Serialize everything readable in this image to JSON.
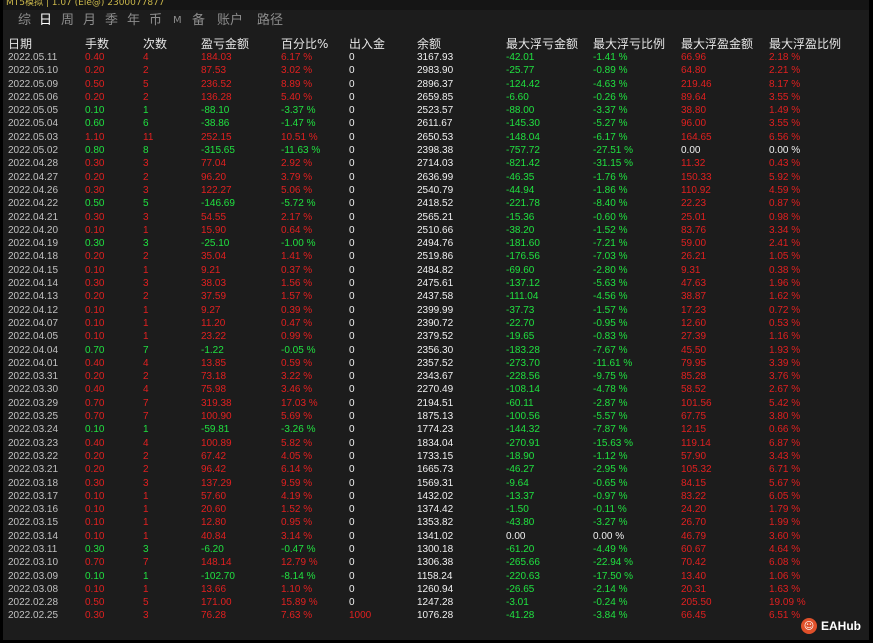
{
  "window": {
    "title": "MT5模拟 | 1.07 (Ele@) 2300077877"
  },
  "tabs": [
    {
      "label": "综",
      "active": false,
      "small": false
    },
    {
      "label": "日",
      "active": true,
      "small": false
    },
    {
      "label": "周",
      "active": false,
      "small": false
    },
    {
      "label": "月",
      "active": false,
      "small": false
    },
    {
      "label": "季",
      "active": false,
      "small": false
    },
    {
      "label": "年",
      "active": false,
      "small": false
    },
    {
      "label": "币",
      "active": false,
      "small": false
    },
    {
      "label": "M",
      "active": false,
      "small": true
    },
    {
      "label": "备",
      "active": false,
      "small": false
    },
    {
      "label": "账户",
      "active": false,
      "small": false
    },
    {
      "label": "路径",
      "active": false,
      "small": false
    }
  ],
  "columns": [
    "日期",
    "手数",
    "次数",
    "盈亏金额",
    "百分比%",
    "出入金",
    "余额",
    "最大浮亏金额",
    "最大浮亏比例",
    "最大浮盈金额",
    "最大浮盈比例"
  ],
  "colors": {
    "loss": "#e02020",
    "profit": "#20e040",
    "neutral": "#f0f0f0",
    "date": "#c0c0c0"
  },
  "rows": [
    [
      "2022.05.11",
      "0.40",
      "4",
      "184.03",
      "6.17 %",
      "0",
      "3167.93",
      "-42.01",
      "-1.41 %",
      "66.96",
      "2.18 %"
    ],
    [
      "2022.05.10",
      "0.20",
      "2",
      "87.53",
      "3.02 %",
      "0",
      "2983.90",
      "-25.77",
      "-0.89 %",
      "64.80",
      "2.21 %"
    ],
    [
      "2022.05.09",
      "0.50",
      "5",
      "236.52",
      "8.89 %",
      "0",
      "2896.37",
      "-124.42",
      "-4.63 %",
      "219.46",
      "8.17 %"
    ],
    [
      "2022.05.06",
      "0.20",
      "2",
      "136.28",
      "5.40 %",
      "0",
      "2659.85",
      "-6.60",
      "-0.26 %",
      "89.64",
      "3.55 %"
    ],
    [
      "2022.05.05",
      "0.10",
      "1",
      "-88.10",
      "-3.37 %",
      "0",
      "2523.57",
      "-88.00",
      "-3.37 %",
      "38.80",
      "1.49 %"
    ],
    [
      "2022.05.04",
      "0.60",
      "6",
      "-38.86",
      "-1.47 %",
      "0",
      "2611.67",
      "-145.30",
      "-5.27 %",
      "96.00",
      "3.55 %"
    ],
    [
      "2022.05.03",
      "1.10",
      "11",
      "252.15",
      "10.51 %",
      "0",
      "2650.53",
      "-148.04",
      "-6.17 %",
      "164.65",
      "6.56 %"
    ],
    [
      "2022.05.02",
      "0.80",
      "8",
      "-315.65",
      "-11.63 %",
      "0",
      "2398.38",
      "-757.72",
      "-27.51 %",
      "0.00",
      "0.00 %"
    ],
    [
      "2022.04.28",
      "0.30",
      "3",
      "77.04",
      "2.92 %",
      "0",
      "2714.03",
      "-821.42",
      "-31.15 %",
      "11.32",
      "0.43 %"
    ],
    [
      "2022.04.27",
      "0.20",
      "2",
      "96.20",
      "3.79 %",
      "0",
      "2636.99",
      "-46.35",
      "-1.76 %",
      "150.33",
      "5.92 %"
    ],
    [
      "2022.04.26",
      "0.30",
      "3",
      "122.27",
      "5.06 %",
      "0",
      "2540.79",
      "-44.94",
      "-1.86 %",
      "110.92",
      "4.59 %"
    ],
    [
      "2022.04.22",
      "0.50",
      "5",
      "-146.69",
      "-5.72 %",
      "0",
      "2418.52",
      "-221.78",
      "-8.40 %",
      "22.23",
      "0.87 %"
    ],
    [
      "2022.04.21",
      "0.30",
      "3",
      "54.55",
      "2.17 %",
      "0",
      "2565.21",
      "-15.36",
      "-0.60 %",
      "25.01",
      "0.98 %"
    ],
    [
      "2022.04.20",
      "0.10",
      "1",
      "15.90",
      "0.64 %",
      "0",
      "2510.66",
      "-38.20",
      "-1.52 %",
      "83.76",
      "3.34 %"
    ],
    [
      "2022.04.19",
      "0.30",
      "3",
      "-25.10",
      "-1.00 %",
      "0",
      "2494.76",
      "-181.60",
      "-7.21 %",
      "59.00",
      "2.41 %"
    ],
    [
      "2022.04.18",
      "0.20",
      "2",
      "35.04",
      "1.41 %",
      "0",
      "2519.86",
      "-176.56",
      "-7.03 %",
      "26.21",
      "1.05 %"
    ],
    [
      "2022.04.15",
      "0.10",
      "1",
      "9.21",
      "0.37 %",
      "0",
      "2484.82",
      "-69.60",
      "-2.80 %",
      "9.31",
      "0.38 %"
    ],
    [
      "2022.04.14",
      "0.30",
      "3",
      "38.03",
      "1.56 %",
      "0",
      "2475.61",
      "-137.12",
      "-5.63 %",
      "47.63",
      "1.96 %"
    ],
    [
      "2022.04.13",
      "0.20",
      "2",
      "37.59",
      "1.57 %",
      "0",
      "2437.58",
      "-111.04",
      "-4.56 %",
      "38.87",
      "1.62 %"
    ],
    [
      "2022.04.12",
      "0.10",
      "1",
      "9.27",
      "0.39 %",
      "0",
      "2399.99",
      "-37.73",
      "-1.57 %",
      "17.23",
      "0.72 %"
    ],
    [
      "2022.04.07",
      "0.10",
      "1",
      "11.20",
      "0.47 %",
      "0",
      "2390.72",
      "-22.70",
      "-0.95 %",
      "12.60",
      "0.53 %"
    ],
    [
      "2022.04.05",
      "0.10",
      "1",
      "23.22",
      "0.99 %",
      "0",
      "2379.52",
      "-19.65",
      "-0.83 %",
      "27.39",
      "1.16 %"
    ],
    [
      "2022.04.04",
      "0.70",
      "7",
      "-1.22",
      "-0.05 %",
      "0",
      "2356.30",
      "-183.28",
      "-7.67 %",
      "45.50",
      "1.93 %"
    ],
    [
      "2022.04.01",
      "0.40",
      "4",
      "13.85",
      "0.59 %",
      "0",
      "2357.52",
      "-273.70",
      "-11.61 %",
      "79.95",
      "3.39 %"
    ],
    [
      "2022.03.31",
      "0.20",
      "2",
      "73.18",
      "3.22 %",
      "0",
      "2343.67",
      "-228.56",
      "-9.75 %",
      "85.28",
      "3.76 %"
    ],
    [
      "2022.03.30",
      "0.40",
      "4",
      "75.98",
      "3.46 %",
      "0",
      "2270.49",
      "-108.14",
      "-4.78 %",
      "58.52",
      "2.67 %"
    ],
    [
      "2022.03.29",
      "0.70",
      "7",
      "319.38",
      "17.03 %",
      "0",
      "2194.51",
      "-60.11",
      "-2.87 %",
      "101.56",
      "5.42 %"
    ],
    [
      "2022.03.25",
      "0.70",
      "7",
      "100.90",
      "5.69 %",
      "0",
      "1875.13",
      "-100.56",
      "-5.57 %",
      "67.75",
      "3.80 %"
    ],
    [
      "2022.03.24",
      "0.10",
      "1",
      "-59.81",
      "-3.26 %",
      "0",
      "1774.23",
      "-144.32",
      "-7.87 %",
      "12.15",
      "0.66 %"
    ],
    [
      "2022.03.23",
      "0.40",
      "4",
      "100.89",
      "5.82 %",
      "0",
      "1834.04",
      "-270.91",
      "-15.63 %",
      "119.14",
      "6.87 %"
    ],
    [
      "2022.03.22",
      "0.20",
      "2",
      "67.42",
      "4.05 %",
      "0",
      "1733.15",
      "-18.90",
      "-1.12 %",
      "57.90",
      "3.43 %"
    ],
    [
      "2022.03.21",
      "0.20",
      "2",
      "96.42",
      "6.14 %",
      "0",
      "1665.73",
      "-46.27",
      "-2.95 %",
      "105.32",
      "6.71 %"
    ],
    [
      "2022.03.18",
      "0.30",
      "3",
      "137.29",
      "9.59 %",
      "0",
      "1569.31",
      "-9.64",
      "-0.65 %",
      "84.15",
      "5.67 %"
    ],
    [
      "2022.03.17",
      "0.10",
      "1",
      "57.60",
      "4.19 %",
      "0",
      "1432.02",
      "-13.37",
      "-0.97 %",
      "83.22",
      "6.05 %"
    ],
    [
      "2022.03.16",
      "0.10",
      "1",
      "20.60",
      "1.52 %",
      "0",
      "1374.42",
      "-1.50",
      "-0.11 %",
      "24.20",
      "1.79 %"
    ],
    [
      "2022.03.15",
      "0.10",
      "1",
      "12.80",
      "0.95 %",
      "0",
      "1353.82",
      "-43.80",
      "-3.27 %",
      "26.70",
      "1.99 %"
    ],
    [
      "2022.03.14",
      "0.10",
      "1",
      "40.84",
      "3.14 %",
      "0",
      "1341.02",
      "0.00",
      "0.00 %",
      "46.79",
      "3.60 %"
    ],
    [
      "2022.03.11",
      "0.30",
      "3",
      "-6.20",
      "-0.47 %",
      "0",
      "1300.18",
      "-61.20",
      "-4.49 %",
      "60.67",
      "4.64 %"
    ],
    [
      "2022.03.10",
      "0.70",
      "7",
      "148.14",
      "12.79 %",
      "0",
      "1306.38",
      "-265.66",
      "-22.94 %",
      "70.42",
      "6.08 %"
    ],
    [
      "2022.03.09",
      "0.10",
      "1",
      "-102.70",
      "-8.14 %",
      "0",
      "1158.24",
      "-220.63",
      "-17.50 %",
      "13.40",
      "1.06 %"
    ],
    [
      "2022.03.08",
      "0.10",
      "1",
      "13.66",
      "1.10 %",
      "0",
      "1260.94",
      "-26.65",
      "-2.14 %",
      "20.31",
      "1.63 %"
    ],
    [
      "2022.02.28",
      "0.50",
      "5",
      "171.00",
      "15.89 %",
      "0",
      "1247.28",
      "-3.01",
      "-0.24 %",
      "205.50",
      "19.09 %"
    ],
    [
      "2022.02.25",
      "0.30",
      "3",
      "76.28",
      "7.63 %",
      "1000",
      "1076.28",
      "-41.28",
      "-3.84 %",
      "66.45",
      "6.51 %"
    ]
  ],
  "watermark": {
    "icon": "eahub-logo-icon",
    "text": "EAHub"
  }
}
